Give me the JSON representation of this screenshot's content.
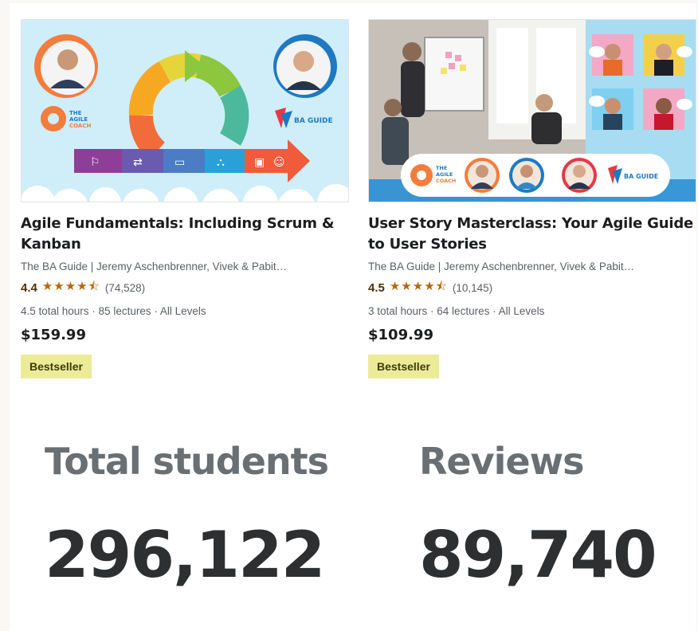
{
  "courses": [
    {
      "title": "Agile Fundamentals: Including Scrum & Kanban",
      "instructors": "The BA Guide | Jeremy Aschenbrenner, Vivek & Pabit…",
      "rating": "4.4",
      "stars_value": 4.4,
      "stars": "★★★★⯪",
      "review_count": "(74,528)",
      "meta": "4.5 total hours · 85 lectures · All Levels",
      "price": "$159.99",
      "badge": "Bestseller",
      "thumb_logo_left": "THE AGILE COACH",
      "thumb_logo_right": "THE BA GUIDE"
    },
    {
      "title": "User Story Masterclass: Your Agile Guide to User Stories",
      "instructors": "The BA Guide | Jeremy Aschenbrenner, Vivek & Pabit…",
      "rating": "4.5",
      "stars_value": 4.5,
      "stars": "★★★★⯪",
      "review_count": "(10,145)",
      "meta": "3 total hours · 64 lectures · All Levels",
      "price": "$109.99",
      "badge": "Bestseller",
      "thumb_logo_left": "THE AGILE COACH",
      "thumb_logo_right": "THE BA GUIDE"
    }
  ],
  "stats": {
    "students_label": "Total students",
    "students_value": "296,122",
    "reviews_label": "Reviews",
    "reviews_value": "89,740"
  },
  "colors": {
    "star": "#b4690e",
    "badge_bg": "#eceb98",
    "rating_num": "#4d3105"
  }
}
